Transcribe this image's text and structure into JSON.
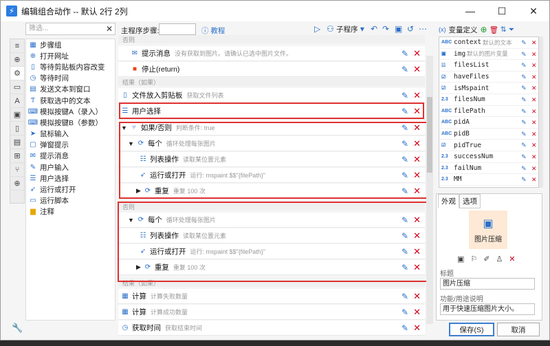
{
  "window": {
    "title": "编辑组合动作 -- 默认 2行 2列",
    "app_icon": "lightning-icon"
  },
  "left_panel": {
    "filter_placeholder": "筛选...",
    "tabs": [
      "list-icon",
      "globe-icon",
      "gear-icon",
      "window-icon",
      "font-icon",
      "image-icon",
      "clipboard-icon",
      "document-icon",
      "windows-icon",
      "branch-icon",
      "globe-icon"
    ],
    "tools": [
      {
        "label": "步骤组",
        "icon": "group-icon"
      },
      {
        "label": "打开网址",
        "icon": "globe-icon"
      },
      {
        "label": "等待剪贴板内容改变",
        "icon": "clipboard-icon"
      },
      {
        "label": "等待时间",
        "icon": "clock-icon"
      },
      {
        "label": "发送文本到窗口",
        "icon": "send-text-icon"
      },
      {
        "label": "获取选中的文本",
        "icon": "text-select-icon"
      },
      {
        "label": "模拟按键A（录入）",
        "icon": "keyboard-icon"
      },
      {
        "label": "模拟按键B（参数）",
        "icon": "keyboard-icon"
      },
      {
        "label": "鼠标输入",
        "icon": "cursor-icon"
      },
      {
        "label": "弹窗提示",
        "icon": "popup-icon"
      },
      {
        "label": "提示消息",
        "icon": "message-icon"
      },
      {
        "label": "用户输入",
        "icon": "user-input-icon"
      },
      {
        "label": "用户选择",
        "icon": "user-select-icon"
      },
      {
        "label": "运行或打开",
        "icon": "run-icon"
      },
      {
        "label": "运行脚本",
        "icon": "script-icon"
      },
      {
        "label": "注释",
        "icon": "note-icon"
      }
    ]
  },
  "main": {
    "steps_label": "主程序步骤:",
    "tutorial_label": "教程",
    "subprogram_label": "子程序",
    "sections": {
      "else1": "否则",
      "result1": "结果（如果）",
      "else2": "否则",
      "result2": "结果（如果）"
    },
    "rows": {
      "r1": {
        "title": "提示消息",
        "desc": "没有获取到图片。请确认已选中图片文件。"
      },
      "r2": {
        "title": "停止(return)",
        "desc": ""
      },
      "r3": {
        "title": "文件放入剪贴板",
        "desc": "获取文件列表"
      },
      "r4": {
        "title": "用户选择",
        "desc": ""
      },
      "r5": {
        "title": "如果/否则",
        "desc": "判断条件: true"
      },
      "r6": {
        "title": "每个",
        "desc": "循环处理每张图片"
      },
      "r7": {
        "title": "列表操作",
        "desc": "读取某位置元素"
      },
      "r8": {
        "title": "运行或打开",
        "desc": "运行:   mspaint $$\"{filePath}\""
      },
      "r9": {
        "title": "重复",
        "desc": "重复 100 次"
      },
      "r10": {
        "title": "每个",
        "desc": "循环处理每张图片"
      },
      "r11": {
        "title": "列表操作",
        "desc": "读取某位置元素"
      },
      "r12": {
        "title": "运行或打开",
        "desc": "运行:   mspaint $$\"{filePath}\""
      },
      "r13": {
        "title": "重复",
        "desc": "重复 100 次"
      },
      "r14": {
        "title": "计算",
        "desc": "计算失败数量"
      },
      "r15": {
        "title": "计算",
        "desc": "计算成功数量"
      },
      "r16": {
        "title": "获取时间",
        "desc": "获取结束时间"
      }
    }
  },
  "variables": {
    "header": "变量定义",
    "items": [
      {
        "type": "ABC",
        "name": "context",
        "desc": "默认的文本"
      },
      {
        "type": "IMG",
        "name": "img",
        "desc": "默认的图片变量"
      },
      {
        "type": "LIST",
        "name": "filesList",
        "desc": ""
      },
      {
        "type": "BOOL",
        "name": "haveFiles",
        "desc": ""
      },
      {
        "type": "BOOL",
        "name": "isMspaint",
        "desc": ""
      },
      {
        "type": "2.3",
        "name": "filesNum",
        "desc": ""
      },
      {
        "type": "ABC",
        "name": "filePath",
        "desc": ""
      },
      {
        "type": "ABC",
        "name": "pidA",
        "desc": ""
      },
      {
        "type": "ABC",
        "name": "pidB",
        "desc": ""
      },
      {
        "type": "BOOL",
        "name": "pidTrue",
        "desc": ""
      },
      {
        "type": "2.3",
        "name": "successNum",
        "desc": ""
      },
      {
        "type": "2.3",
        "name": "failNum",
        "desc": ""
      },
      {
        "type": "2.3",
        "name": "MM",
        "desc": ""
      }
    ]
  },
  "appearance": {
    "tab_appearance": "外观",
    "tab_options": "选项",
    "tile_label": "图片压缩",
    "title_label": "标题",
    "title_value": "图片压缩",
    "desc_label": "功能/用途说明",
    "desc_value": "用于快速压缩图片大小。"
  },
  "buttons": {
    "save": "保存(S)",
    "cancel": "取消"
  },
  "colors": {
    "accent": "#2a6fc9",
    "highlight": "#e03030",
    "delete": "#d0021b"
  }
}
